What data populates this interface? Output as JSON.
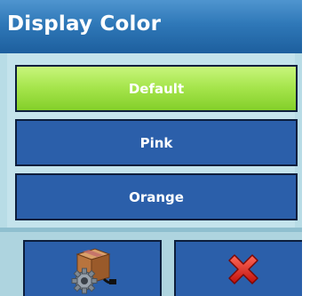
{
  "dialog": {
    "title": "Display Color"
  },
  "options": [
    {
      "label": "Default",
      "selected": true
    },
    {
      "label": "Pink",
      "selected": false
    },
    {
      "label": "Orange",
      "selected": false
    }
  ],
  "footer": {
    "ok_icon": "settings-box-icon",
    "cancel_icon": "red-x-icon"
  },
  "colors": {
    "title_bar": "#2f78b8",
    "selected_option": "#a4e44a",
    "option": "#2b5faa",
    "background": "#b8dce6",
    "cancel_x": "#e0201c"
  }
}
